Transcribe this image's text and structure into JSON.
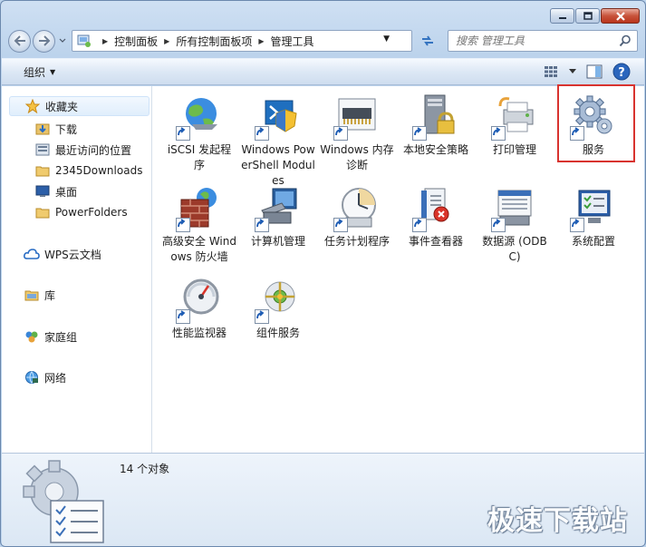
{
  "window": {
    "caption": {
      "minimize": "minimize",
      "maximize": "maximize",
      "close": "close"
    }
  },
  "navbar": {
    "breadcrumbs": [
      "控制面板",
      "所有控制面板项",
      "管理工具"
    ],
    "search_placeholder": "搜索 管理工具"
  },
  "toolbar": {
    "organize_label": "组织"
  },
  "sidebar": {
    "favorites": "收藏夹",
    "items": [
      {
        "label": "下载",
        "icon": "download-folder-icon"
      },
      {
        "label": "最近访问的位置",
        "icon": "recent-places-icon"
      },
      {
        "label": "2345Downloads",
        "icon": "folder-icon"
      },
      {
        "label": "桌面",
        "icon": "desktop-icon"
      },
      {
        "label": "PowerFolders",
        "icon": "folder-icon"
      }
    ],
    "wps": "WPS云文档",
    "libraries": "库",
    "homegroup": "家庭组",
    "network": "网络"
  },
  "tiles": [
    {
      "id": "iscsi",
      "label": "iSCSI 发起程序"
    },
    {
      "id": "powershell",
      "label": "Windows PowerShell Modules"
    },
    {
      "id": "memdiag",
      "label": "Windows 内存诊断"
    },
    {
      "id": "secpol",
      "label": "本地安全策略"
    },
    {
      "id": "printmgmt",
      "label": "打印管理"
    },
    {
      "id": "services",
      "label": "服务"
    },
    {
      "id": "firewall",
      "label": "高级安全 Windows 防火墙"
    },
    {
      "id": "compmgmt",
      "label": "计算机管理"
    },
    {
      "id": "tasksched",
      "label": "任务计划程序"
    },
    {
      "id": "eventvwr",
      "label": "事件查看器"
    },
    {
      "id": "odbc",
      "label": "数据源 (ODBC)"
    },
    {
      "id": "msconfig",
      "label": "系统配置"
    },
    {
      "id": "perfmon",
      "label": "性能监视器"
    },
    {
      "id": "comexp",
      "label": "组件服务"
    }
  ],
  "details": {
    "count": "14 个对象"
  },
  "watermark": "极速下载站",
  "colors": {
    "highlight": "#d8332f",
    "accent": "#2a6dc4"
  }
}
